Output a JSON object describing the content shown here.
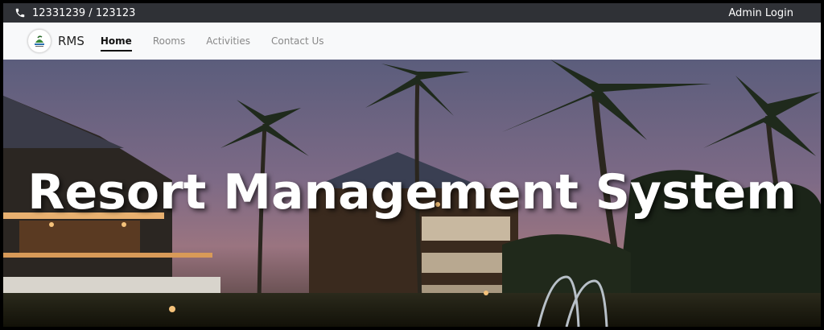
{
  "topbar": {
    "phone_icon": "phone-icon",
    "phone_text": "12331239 / 123123",
    "admin_login": "Admin Login"
  },
  "navbar": {
    "brand": "RMS",
    "logo_icon": "resort-logo-icon",
    "links": [
      {
        "label": "Home",
        "active": true
      },
      {
        "label": "Rooms",
        "active": false
      },
      {
        "label": "Activities",
        "active": false
      },
      {
        "label": "Contact Us",
        "active": false
      }
    ]
  },
  "hero": {
    "title": "Resort Management System"
  },
  "colors": {
    "topbar_bg": "#2f3136",
    "navbar_bg": "#f8f9fa",
    "hero_text": "#ffffff"
  }
}
